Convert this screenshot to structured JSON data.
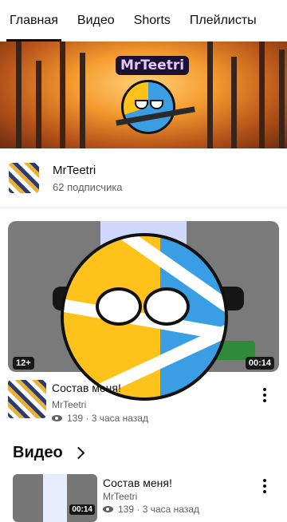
{
  "tabs": [
    {
      "label": "Главная"
    },
    {
      "label": "Видео"
    },
    {
      "label": "Shorts"
    },
    {
      "label": "Плейлисты"
    }
  ],
  "banner": {
    "title": "MrTeetri"
  },
  "channel": {
    "name": "MrTeetri",
    "subscribers": "62 подписчика"
  },
  "featured": {
    "age_rating": "12+",
    "duration": "00:14",
    "title": "Состав меня!",
    "channel": "MrTeetri",
    "views": "139",
    "age": "3 часа назад"
  },
  "videos_section": {
    "title": "Видео"
  },
  "video_item": {
    "title": "Состав меня!",
    "channel": "MrTeetri",
    "views": "139",
    "age": "3 часа назад",
    "duration": "00:14"
  },
  "colors": {
    "flag_blue": "#3a9ee4",
    "flag_yellow": "#ffc21a"
  }
}
